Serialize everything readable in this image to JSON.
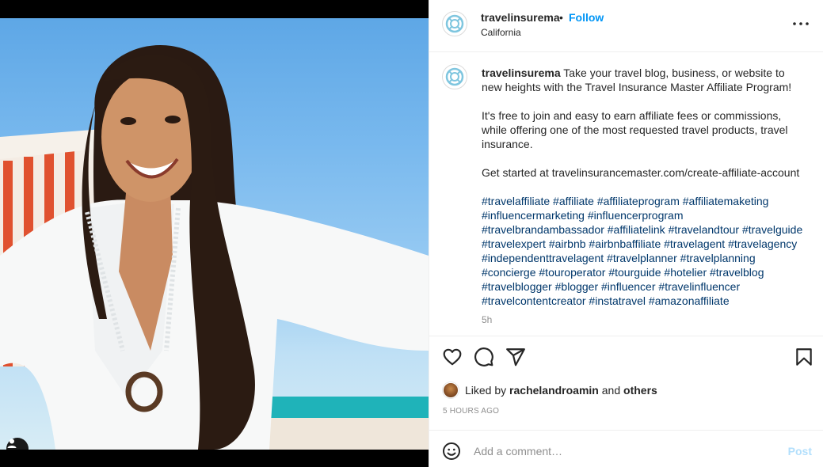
{
  "post": {
    "username": "travelinsurema",
    "separator": "•",
    "follow_label": "Follow",
    "location": "California",
    "more_icon": "more-horizontal-icon",
    "avatar_icon": "lifebuoy-logo-icon"
  },
  "caption": {
    "username": "travelinsurema",
    "intro": "Take your travel blog, business, or website to new heights with the Travel Insurance Master Affiliate Program!",
    "paragraph2": "It's free to join and easy to earn affiliate fees or commissions, while offering one of the most requested travel products, travel insurance.",
    "paragraph3": "Get started at travelinsurancemaster.com/create-affiliate-account",
    "hashtags": [
      "#travelaffiliate",
      "#affiliate",
      "#affiliateprogram",
      "#affiliatemaketing",
      "#influencermarketing",
      "#influencerprogram",
      "#travelbrandambassador",
      "#affiliatelink",
      "#travelandtour",
      "#travelguide",
      "#travelexpert",
      "#airbnb",
      "#airbnbaffiliate",
      "#travelagent",
      "#travelagency",
      "#independenttravelagent",
      "#travelplanner",
      "#travelplanning",
      "#concierge",
      "#touroperator",
      "#tourguide",
      "#hotelier",
      "#travelblog",
      "#travelblogger",
      "#blogger",
      "#influencer",
      "#travelinfluencer",
      "#travelcontentcreator",
      "#instatravel",
      "#amazonaffiliate"
    ],
    "age": "5h"
  },
  "actions": {
    "like_icon": "heart-icon",
    "comment_icon": "comment-icon",
    "share_icon": "paper-plane-icon",
    "save_icon": "bookmark-icon"
  },
  "likes": {
    "prefix": "Liked by",
    "user": "rachelandroamin",
    "joiner": "and",
    "others": "others"
  },
  "timestamp": "5 HOURS AGO",
  "add_comment": {
    "placeholder": "Add a comment…",
    "post_label": "Post",
    "emoji_icon": "smiley-icon"
  },
  "media": {
    "user_tag_icon": "user-tag-icon"
  },
  "colors": {
    "link_blue": "#0095f6",
    "hashtag": "#00376b",
    "muted": "#8e8e8e",
    "post_disabled": "#b2dffc"
  }
}
